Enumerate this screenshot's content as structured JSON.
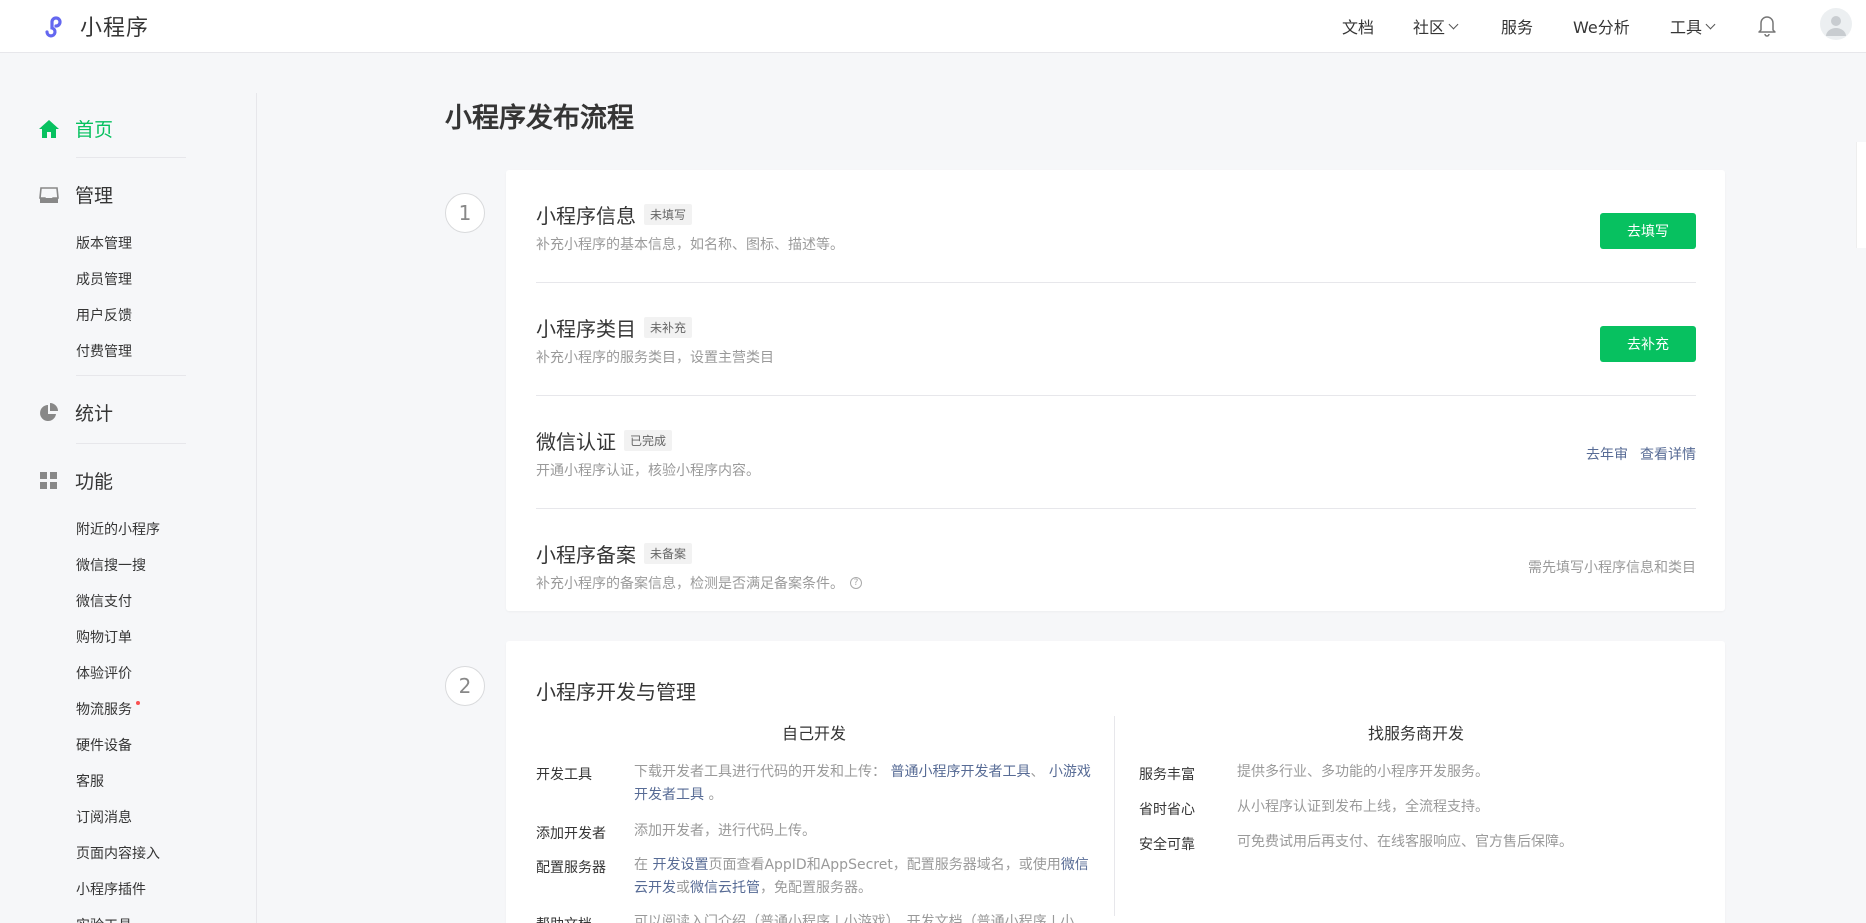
{
  "header": {
    "logo_text": "小程序",
    "nav": [
      {
        "label": "文档",
        "has_caret": false
      },
      {
        "label": "社区",
        "has_caret": true
      },
      {
        "label": "服务",
        "has_caret": false
      },
      {
        "label": "We分析",
        "has_caret": false
      },
      {
        "label": "工具",
        "has_caret": true
      }
    ],
    "icons": [
      "bell-icon",
      "avatar-icon"
    ]
  },
  "sidebar": {
    "home": {
      "label": "首页",
      "icon": "home-icon",
      "active": true
    },
    "manage": {
      "label": "管理",
      "icon": "inbox-icon",
      "items": [
        "版本管理",
        "成员管理",
        "用户反馈",
        "付费管理"
      ]
    },
    "stats": {
      "label": "统计",
      "icon": "pie-chart-icon"
    },
    "features": {
      "label": "功能",
      "icon": "grid-icon",
      "items": [
        "附近的小程序",
        "微信搜一搜",
        "微信支付",
        "购物订单",
        "体验评价",
        "物流服务",
        "硬件设备",
        "客服",
        "订阅消息",
        "页面内容接入",
        "小程序插件",
        "实验工具"
      ]
    }
  },
  "main": {
    "title": "小程序发布流程",
    "step1": {
      "number": "1",
      "rows": [
        {
          "title": "小程序信息",
          "tag": "未填写",
          "desc": "补充小程序的基本信息，如名称、图标、描述等。",
          "button": "去填写"
        },
        {
          "title": "小程序类目",
          "tag": "未补充",
          "desc": "补充小程序的服务类目，设置主营类目",
          "button": "去补充"
        },
        {
          "title": "微信认证",
          "tag": "已完成",
          "desc": "开通小程序认证，核验小程序内容。",
          "link1": "去年审",
          "link2": "查看详情"
        },
        {
          "title": "小程序备案",
          "tag": "未备案",
          "desc": "补充小程序的备案信息，检测是否满足备案条件。",
          "help": "?",
          "hint": "需先填写小程序信息和类目"
        }
      ]
    },
    "step2": {
      "number": "2",
      "title": "小程序开发与管理",
      "left": {
        "heading": "自己开发",
        "tools_key": "开发工具",
        "tools_text": "下载开发者工具进行代码的开发和上传：",
        "tools_link1": "普通小程序开发者工具",
        "tools_sep": "、",
        "tools_link2": "小游戏开发者工具",
        "tools_end": "。",
        "dev_key": "添加开发者",
        "dev_text": "添加开发者，进行代码上传。",
        "server_key": "配置服务器",
        "server_pre": "在",
        "server_link1": "开发设置",
        "server_mid": "页面查看AppID和AppSecret，配置服务器域名，或使用",
        "server_link2": "微信云开发",
        "server_or": "或",
        "server_link3": "微信云托管",
        "server_end": "，免配置服务器。",
        "help_key": "帮助文档",
        "help_text": "可以阅读入门介绍（普通小程序 | 小游戏）、开发文档（普通小程序 | 小"
      },
      "right": {
        "heading": "找服务商开发",
        "items": [
          {
            "key": "服务丰富",
            "value": "提供多行业、多功能的小程序开发服务。"
          },
          {
            "key": "省时省心",
            "value": "从小程序认证到发布上线，全流程支持。"
          },
          {
            "key": "安全可靠",
            "value": "可免费试用后再支付、在线客服响应、官方售后保障。"
          }
        ]
      }
    }
  },
  "colors": {
    "accent": "#07c160",
    "link": "#576b95",
    "muted": "#9a9a9a",
    "text": "#353535"
  }
}
